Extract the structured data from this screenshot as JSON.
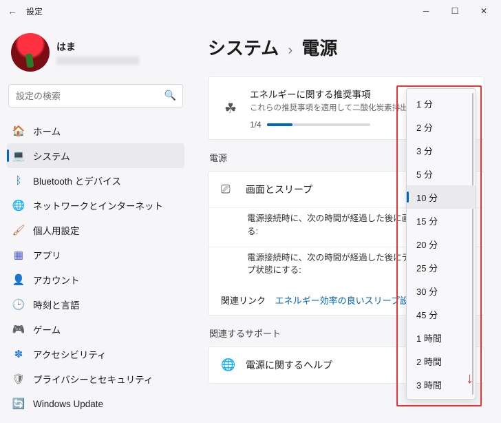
{
  "titlebar": {
    "title": "設定"
  },
  "profile": {
    "name": "はま"
  },
  "search": {
    "placeholder": "設定の検索"
  },
  "nav": [
    {
      "label": "ホーム",
      "icon": "🏠",
      "color": "#e07040"
    },
    {
      "label": "システム",
      "icon": "💻",
      "color": "#2a7ed8",
      "active": true
    },
    {
      "label": "Bluetooth とデバイス",
      "icon": "ᛒ",
      "color": "#1976d2"
    },
    {
      "label": "ネットワークとインターネット",
      "icon": "🌐",
      "color": "#00b2d6"
    },
    {
      "label": "個人用設定",
      "icon": "🖌",
      "color": "#b86a3a"
    },
    {
      "label": "アプリ",
      "icon": "▦",
      "color": "#4a5bd0"
    },
    {
      "label": "アカウント",
      "icon": "👤",
      "color": "#2a9a5a"
    },
    {
      "label": "時刻と言語",
      "icon": "🕒",
      "color": "#555"
    },
    {
      "label": "ゲーム",
      "icon": "🎮",
      "color": "#666"
    },
    {
      "label": "アクセシビリティ",
      "icon": "✽",
      "color": "#2a7ed8"
    },
    {
      "label": "プライバシーとセキュリティ",
      "icon": "🛡",
      "color": "#777"
    },
    {
      "label": "Windows Update",
      "icon": "🔄",
      "color": "#00a0d8"
    }
  ],
  "breadcrumb": {
    "parent": "システム",
    "sep": "›",
    "current": "電源"
  },
  "energy": {
    "title": "エネルギーに関する推奨事項",
    "desc": "これらの推奨事項を適用して二酸化炭素排出",
    "progress_label": "1/4",
    "progress_pct": 25
  },
  "sections": {
    "power": "電源",
    "related_support": "関連するサポート"
  },
  "screen_sleep": {
    "label": "画面とスリープ",
    "sub1": "電源接続時に、次の時間が経過した後に画面の電源を切る:",
    "sub2": "電源接続時に、次の時間が経過した後にデバイスをスリープ状態にする:"
  },
  "related_link": {
    "label": "関連リンク",
    "link_text": "エネルギー効率の良いスリープ設定"
  },
  "help_row": {
    "label": "電源に関するヘルプ"
  },
  "dropdown": {
    "selected_index": 4,
    "options": [
      "1 分",
      "2 分",
      "3 分",
      "5 分",
      "10 分",
      "15 分",
      "20 分",
      "25 分",
      "30 分",
      "45 分",
      "1 時間",
      "2 時間",
      "3 時間"
    ]
  }
}
